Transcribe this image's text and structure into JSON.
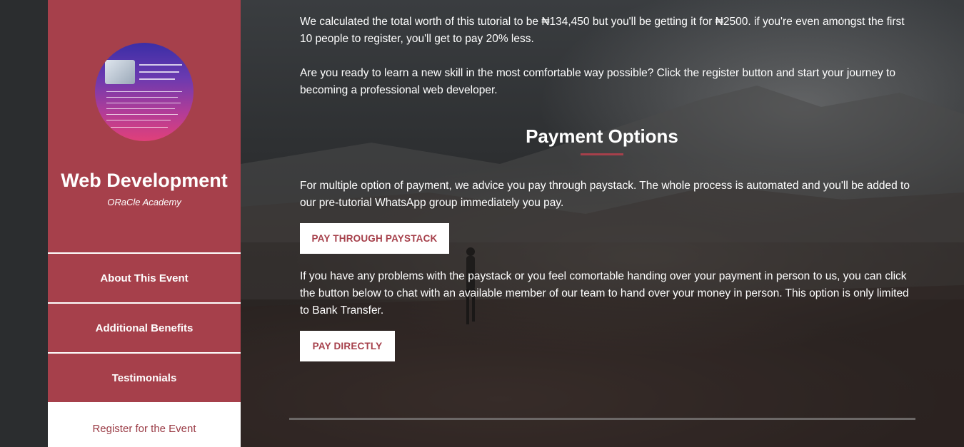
{
  "sidebar": {
    "title": "Web Development",
    "subtitle": "ORaCle Academy",
    "nav": [
      {
        "label": "About This Event"
      },
      {
        "label": "Additional Benefits"
      },
      {
        "label": "Testimonials"
      },
      {
        "label": "Register for the Event"
      }
    ]
  },
  "main": {
    "intro_paragraph": "We calculated the total worth of this tutorial to be ₦134,450 but you'll be getting it for ₦2500. if you're even amongst the first 10 people to register, you'll get to pay 20% less.",
    "cta_paragraph": "Are you ready to learn a new skill in the most comfortable way possible? Click the register button and start your journey to becoming a professional web developer.",
    "section_title": "Payment Options",
    "paystack_paragraph": "For multiple option of payment, we advice you pay through paystack. The whole process is automated and you'll be added to our pre-tutorial WhatsApp group immediately you pay.",
    "paystack_button": "PAY THROUGH PAYSTACK",
    "direct_paragraph": "If you have any problems with the paystack or you feel comortable handing over your payment in person to us, you can click the button below to chat with an available member of our team to hand over your money in person. This option is only limited to Bank Transfer.",
    "direct_button": "PAY DIRECTLY"
  },
  "colors": {
    "accent": "#a6404b",
    "background": "#2d2f31",
    "text": "#ffffff"
  },
  "icons": {
    "logo": "oracle-academy-logo"
  }
}
